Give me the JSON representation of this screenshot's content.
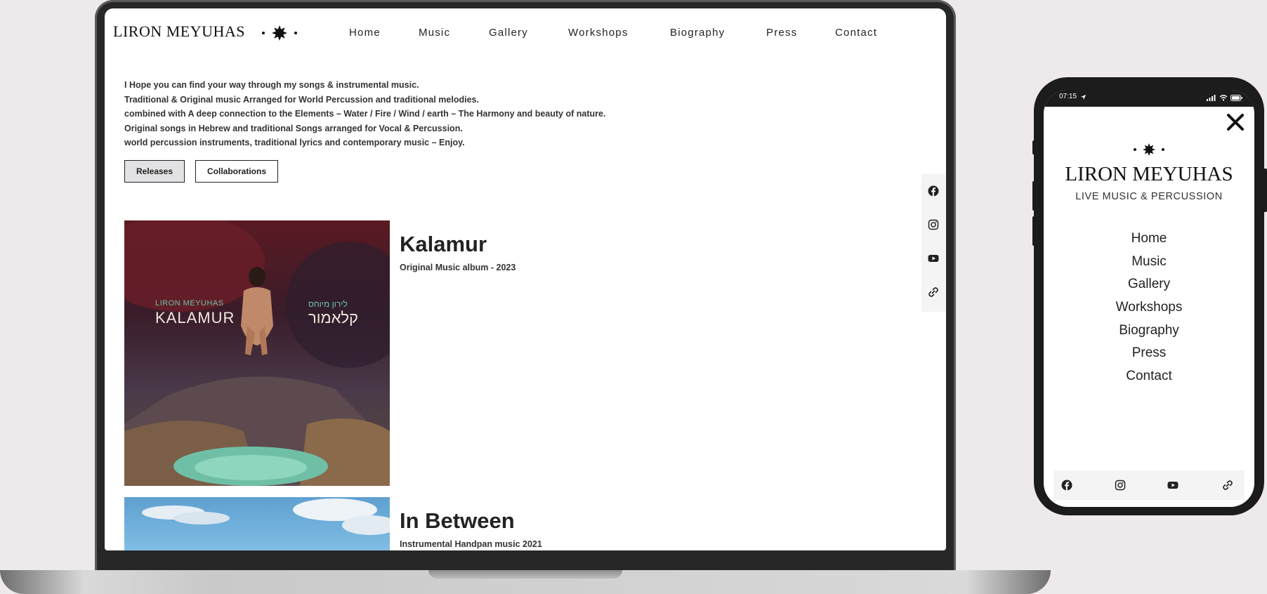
{
  "site": {
    "logo": "LIRON MEYUHAS",
    "nav": [
      "Home",
      "Music",
      "Gallery",
      "Workshops",
      "Biography",
      "Press",
      "Contact"
    ],
    "intro_lines": [
      "I Hope you can find your way through my songs & instrumental music.",
      "Traditional & Original music Arranged for World Percussion and traditional melodies.",
      "combined with A deep connection to the Elements – Water / Fire / Wind / earth – The Harmony and beauty of nature.",
      "Original songs in Hebrew and traditional Songs arranged for Vocal & Percussion.",
      "world percussion instruments, traditional lyrics and contemporary music – Enjoy."
    ],
    "filters": [
      {
        "label": "Releases",
        "active": true
      },
      {
        "label": "Collaborations",
        "active": false
      }
    ],
    "albums": [
      {
        "title": "Kalamur",
        "subtitle": "Original Music album - 2023",
        "cover_artist": "LIRON MEYUHAS",
        "cover_title": "KALAMUR",
        "cover_hebrew": "לירון מיוחס",
        "cover_hebrew_title": "קלאמור"
      },
      {
        "title": "In Between",
        "subtitle": "Instrumental Handpan music 2021"
      }
    ],
    "social_icons": [
      "facebook-icon",
      "instagram-icon",
      "youtube-icon",
      "link-icon"
    ]
  },
  "phone": {
    "status_time": "07:15",
    "logo": "LIRON MEYUHAS",
    "tagline": "LIVE MUSIC & PERCUSSION",
    "nav": [
      "Home",
      "Music",
      "Gallery",
      "Workshops",
      "Biography",
      "Press",
      "Contact"
    ]
  },
  "colors": {
    "background": "#eeeaeb",
    "device_frame": "#272727",
    "text": "#222222",
    "active_filter": "#e2e2e4",
    "social_bar": "#f4f4f4"
  }
}
